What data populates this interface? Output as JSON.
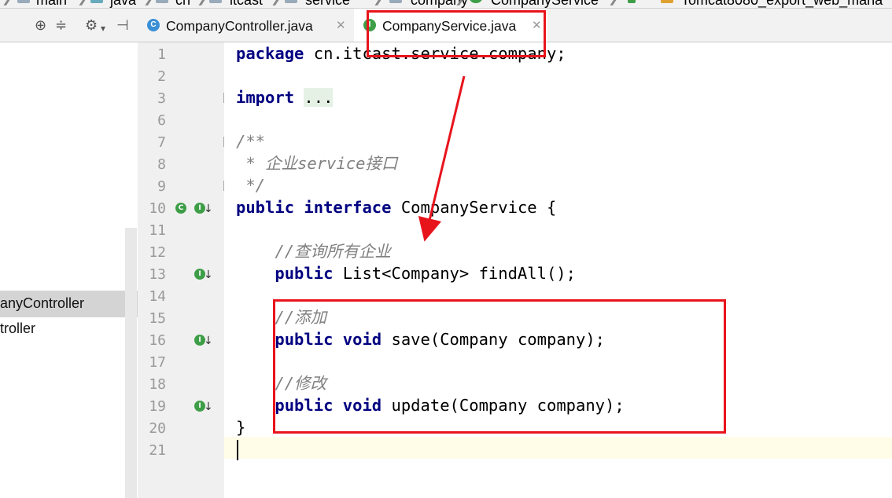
{
  "breadcrumbs": [
    "main",
    "java",
    "cn",
    "itcast",
    "service",
    "company",
    "CompanyService"
  ],
  "run_config": "Tomcat8080_export_web_mana",
  "tabs": [
    {
      "label": "CompanyController.java",
      "icon": "C",
      "active": false
    },
    {
      "label": "CompanyService.java",
      "icon": "I",
      "active": true
    }
  ],
  "tree": {
    "selected": "anyController",
    "next": "troller"
  },
  "line_numbers": [
    "1",
    "2",
    "3",
    "6",
    "7",
    "8",
    "9",
    "10",
    "11",
    "12",
    "13",
    "14",
    "15",
    "16",
    "17",
    "18",
    "19",
    "20",
    "21"
  ],
  "code": {
    "l1_kw": "package",
    "l1_rest": " cn.itcast.service.company;",
    "l3_kw": "import",
    "l3_fold": "...",
    "l7": "/**",
    "l8": " * 企业service接口",
    "l9": " */",
    "l10_kw1": "public",
    "l10_kw2": "interface",
    "l10_rest": " CompanyService {",
    "l12": "    //查询所有企业",
    "l13_kw": "public",
    "l13_rest": " List<Company> findAll();",
    "l15": "    //添加",
    "l16_kw1": "public",
    "l16_kw2": "void",
    "l16_rest": " save(Company company);",
    "l18": "    //修改",
    "l19_kw1": "public",
    "l19_kw2": "void",
    "l19_rest": " update(Company company);",
    "l20": "}"
  },
  "colors": {
    "annotation": "#e8141c",
    "keyword": "#000080",
    "comment": "#808080",
    "interface_icon": "#3d9e47"
  }
}
